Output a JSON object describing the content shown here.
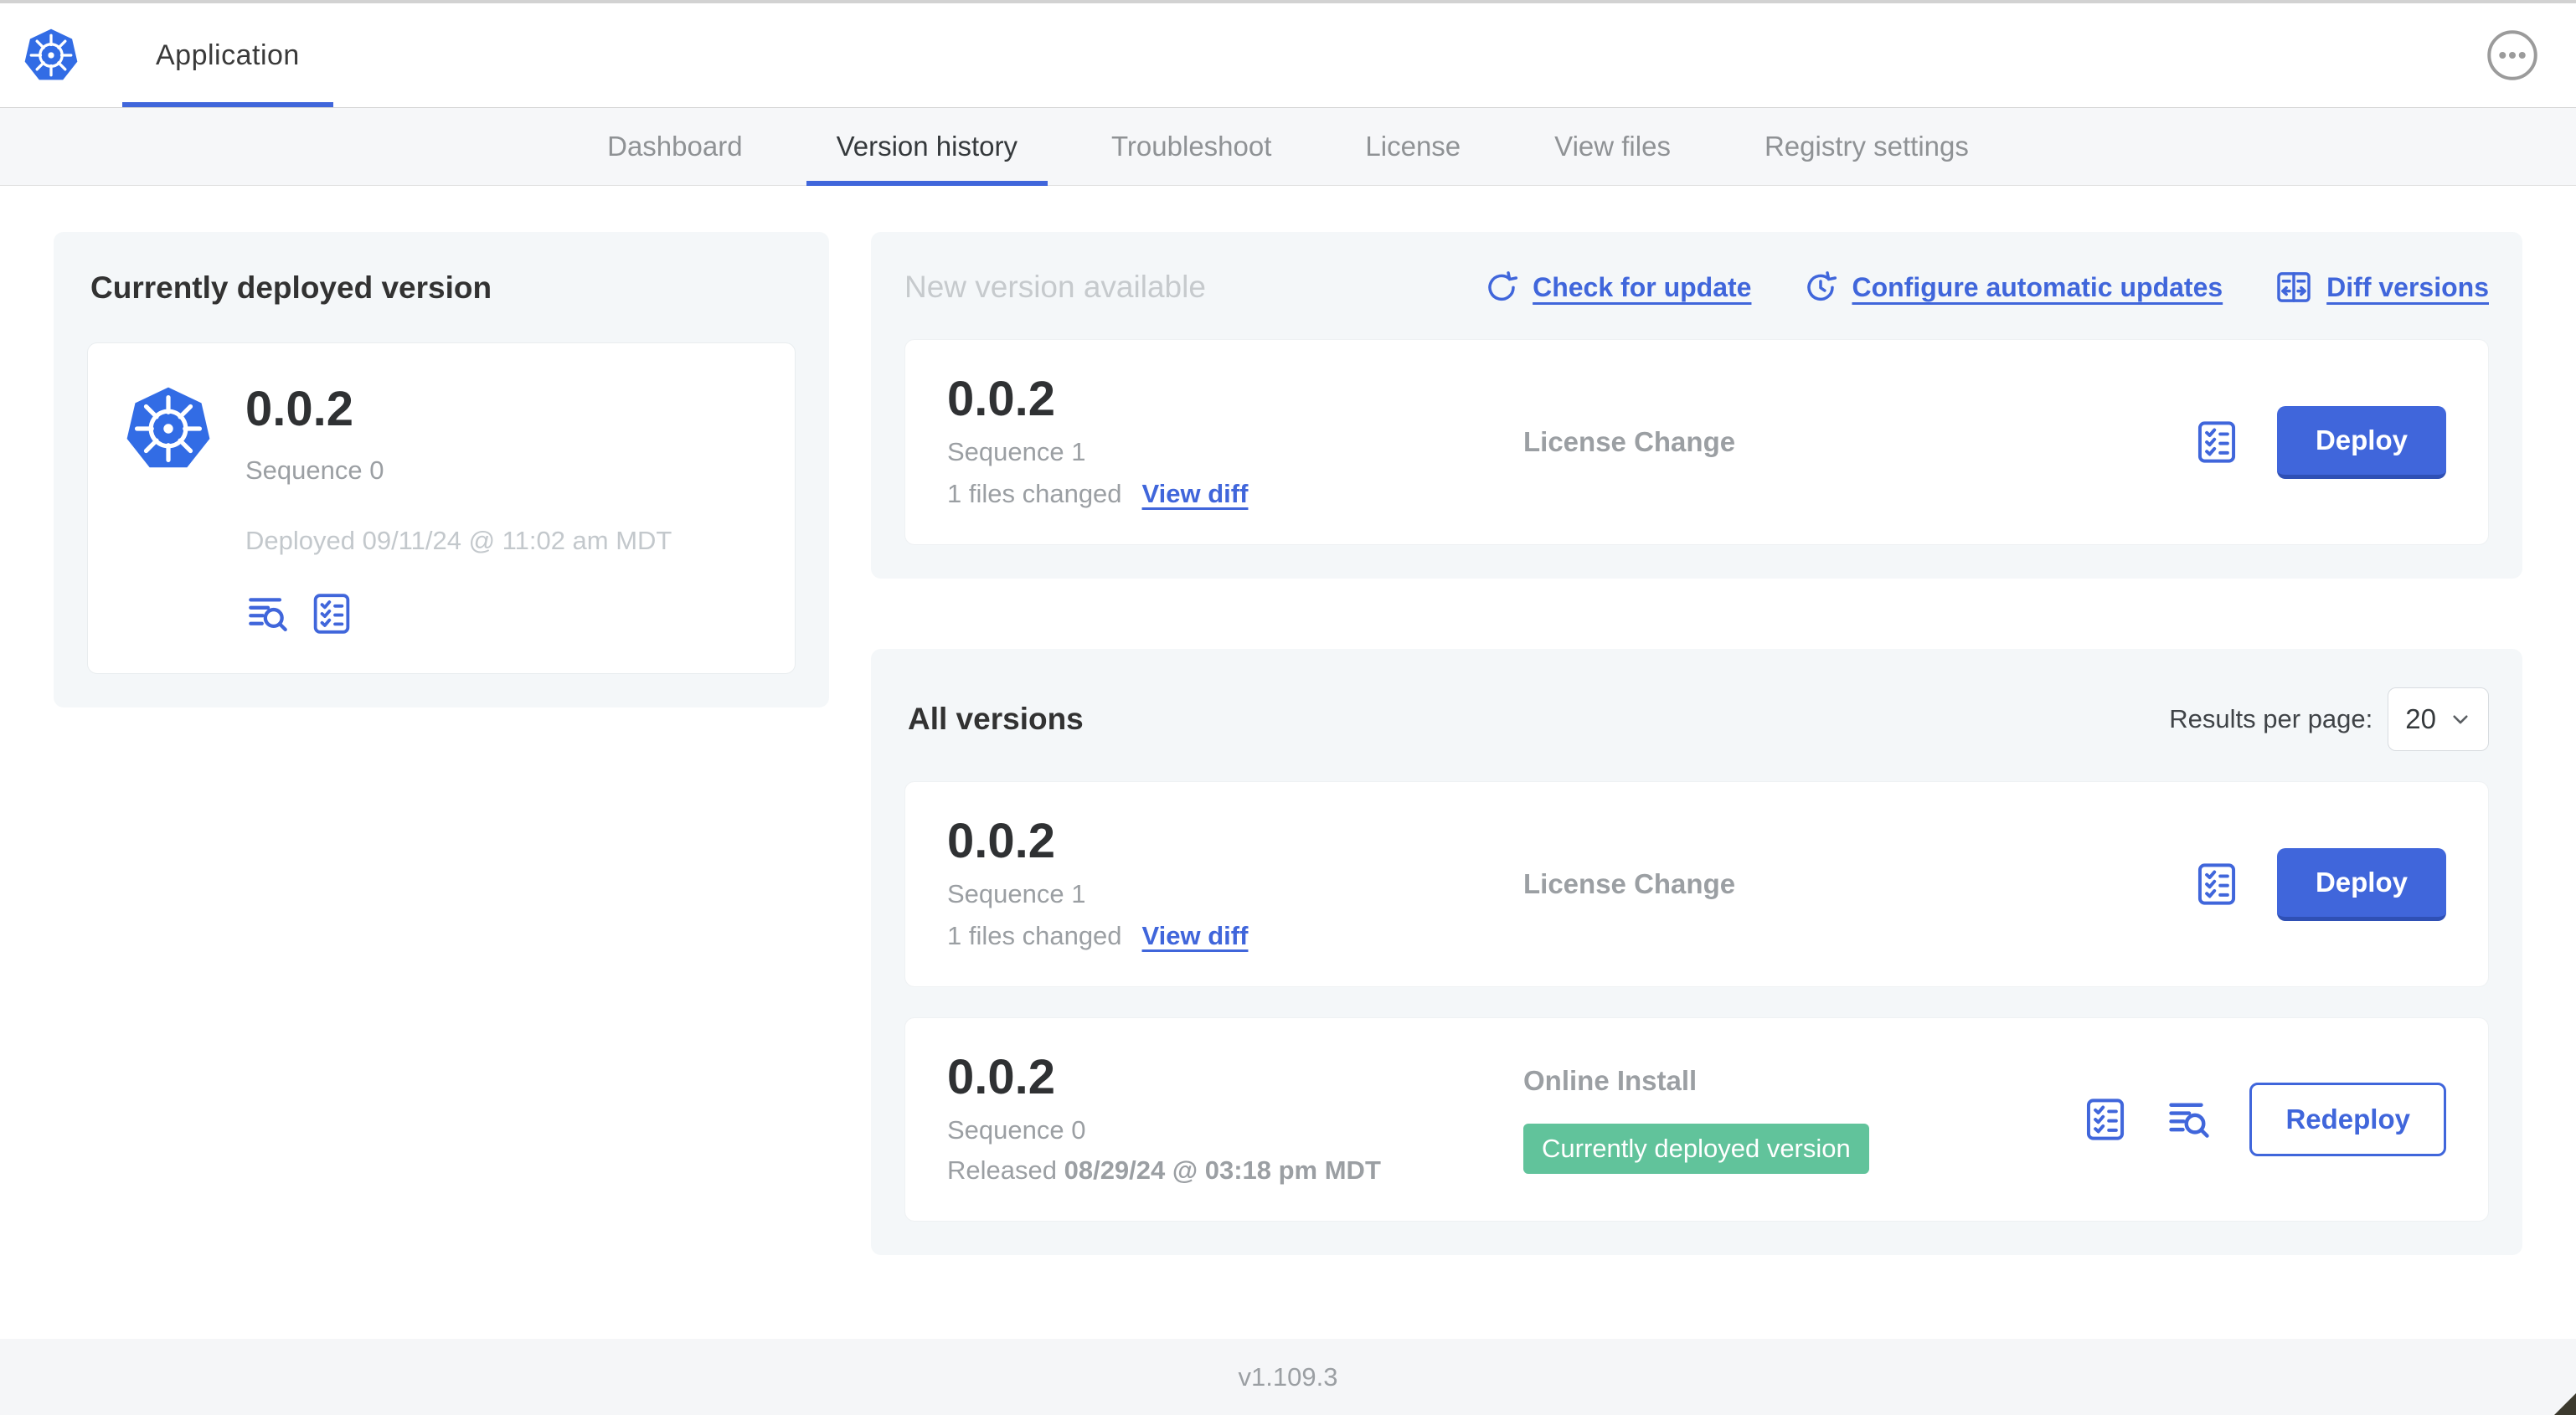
{
  "colors": {
    "accent_blue": "#4066db",
    "kubernetes_blue": "#326ce5",
    "badge_green": "#61c39b"
  },
  "header": {
    "app_title": "Application",
    "logo_icon": "kubernetes-logo-icon",
    "more_menu_icon": "ellipsis-icon"
  },
  "nav": {
    "tabs": [
      {
        "label": "Dashboard",
        "active": false
      },
      {
        "label": "Version history",
        "active": true
      },
      {
        "label": "Troubleshoot",
        "active": false
      },
      {
        "label": "License",
        "active": false
      },
      {
        "label": "View files",
        "active": false
      },
      {
        "label": "Registry settings",
        "active": false
      }
    ]
  },
  "current_version": {
    "title": "Currently deployed version",
    "version": "0.0.2",
    "sequence": "Sequence 0",
    "deployed": "Deployed 09/11/24 @ 11:02 am MDT",
    "icons": [
      "view-logs-icon",
      "preflight-checks-icon"
    ]
  },
  "new_version": {
    "title": "New version available",
    "links": {
      "check_for_update": "Check for update",
      "configure_automatic_updates": "Configure automatic updates",
      "diff_versions": "Diff versions"
    },
    "link_icons": [
      "refresh-icon",
      "clock-refresh-icon",
      "diff-columns-icon"
    ],
    "card": {
      "version": "0.0.2",
      "sequence": "Sequence 1",
      "files_changed": "1 files changed",
      "view_diff": "View diff",
      "source": "License Change",
      "deploy_label": "Deploy",
      "icons": [
        "preflight-checks-icon"
      ]
    }
  },
  "all_versions": {
    "title": "All versions",
    "results_per_page_label": "Results per page:",
    "results_per_page_value": "20",
    "rows": [
      {
        "version": "0.0.2",
        "sequence": "Sequence 1",
        "files_changed": "1 files changed",
        "view_diff": "View diff",
        "source": "License Change",
        "action_label": "Deploy",
        "icons": [
          "preflight-checks-icon"
        ]
      },
      {
        "version": "0.0.2",
        "sequence": "Sequence 0",
        "released_prefix": "Released ",
        "released_date": "08/29/24 @ 03:18 pm MDT",
        "source": "Online Install",
        "badge": "Currently deployed version",
        "action_label": "Redeploy",
        "icons": [
          "preflight-checks-icon",
          "view-logs-icon"
        ]
      }
    ]
  },
  "footer": {
    "app_version": "v1.109.3"
  }
}
